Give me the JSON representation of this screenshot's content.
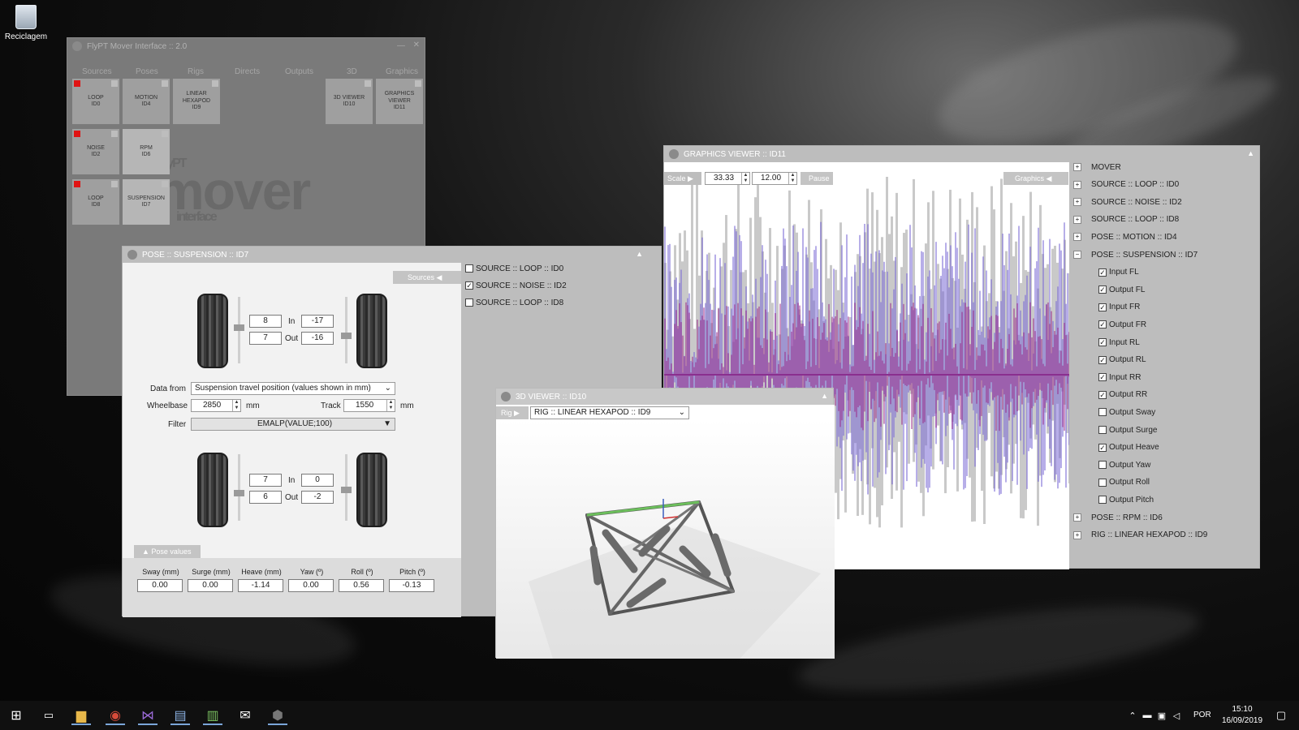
{
  "desktop": {
    "recycle_label": "Reciclagem"
  },
  "main_window": {
    "title": "FlyPT Mover Interface :: 2.0",
    "tabs": [
      "Sources",
      "Poses",
      "Rigs",
      "Directs",
      "Outputs",
      "3D",
      "Graphics"
    ],
    "modules": [
      {
        "label": "LOOP\nID0",
        "active": true
      },
      {
        "label": "MOTION\nID4",
        "active": false
      },
      {
        "label": "LINEAR\nHEXAPOD\nID9",
        "active": false
      },
      {
        "label": "3D VIEWER\nID10",
        "active": false
      },
      {
        "label": "GRAPHICS\nVIEWER\nID11",
        "active": false
      },
      {
        "label": "NOISE\nID2",
        "active": true
      },
      {
        "label": "RPM\nID6",
        "active": false
      },
      {
        "label": "LOOP\nID8",
        "active": true
      },
      {
        "label": "SUSPENSION\nID7",
        "active": false
      }
    ],
    "logo_small": "FlyPT",
    "logo_big": "mover",
    "logo_sub": "interface"
  },
  "pose_window": {
    "title": "POSE :: SUSPENSION :: ID7",
    "sources_button": "Sources",
    "front": {
      "in_left": "8",
      "in_right": "-17",
      "out_left": "7",
      "out_right": "-16"
    },
    "rear": {
      "in_left": "7",
      "in_right": "0",
      "out_left": "6",
      "out_right": "-2"
    },
    "in_label": "In",
    "out_label": "Out",
    "data_from_label": "Data from",
    "data_from_value": "Suspension travel position (values shown in mm)",
    "wheelbase_label": "Wheelbase",
    "wheelbase_value": "2850",
    "track_label": "Track",
    "track_value": "1550",
    "unit_mm": "mm",
    "filter_label": "Filter",
    "filter_value": "EMALP(VALUE;100)",
    "pose_values_label": "Pose values",
    "pose_headers": [
      "Sway (mm)",
      "Surge (mm)",
      "Heave (mm)",
      "Yaw (º)",
      "Roll (º)",
      "Pitch (º)"
    ],
    "pose_values": [
      "0.00",
      "0.00",
      "-1.14",
      "0.00",
      "0.56",
      "-0.13"
    ],
    "sources": [
      {
        "label": "SOURCE :: LOOP :: ID0",
        "checked": false
      },
      {
        "label": "SOURCE :: NOISE :: ID2",
        "checked": true
      },
      {
        "label": "SOURCE :: LOOP :: ID8",
        "checked": false
      }
    ]
  },
  "graphics_window": {
    "title": "GRAPHICS VIEWER :: ID11",
    "scale_label": "Scale",
    "scale_value1": "33.33",
    "scale_value2": "12.00",
    "pause_label": "Pause",
    "graphics_button": "Graphics",
    "tree_top": [
      "MOVER",
      "SOURCE :: LOOP :: ID0",
      "SOURCE :: NOISE :: ID2",
      "SOURCE :: LOOP :: ID8",
      "POSE :: MOTION :: ID4",
      "POSE :: SUSPENSION :: ID7"
    ],
    "tree_children": [
      {
        "label": "Input FL",
        "checked": true
      },
      {
        "label": "Output FL",
        "checked": true
      },
      {
        "label": "Input FR",
        "checked": true
      },
      {
        "label": "Output FR",
        "checked": true
      },
      {
        "label": "Input RL",
        "checked": true
      },
      {
        "label": "Output RL",
        "checked": true
      },
      {
        "label": "Input RR",
        "checked": true
      },
      {
        "label": "Output RR",
        "checked": true
      },
      {
        "label": "Output Sway",
        "checked": false
      },
      {
        "label": "Output Surge",
        "checked": false
      },
      {
        "label": "Output Heave",
        "checked": true
      },
      {
        "label": "Output Yaw",
        "checked": false
      },
      {
        "label": "Output Roll",
        "checked": false
      },
      {
        "label": "Output Pitch",
        "checked": false
      }
    ],
    "tree_bottom": [
      "POSE :: RPM :: ID6",
      "RIG :: LINEAR HEXAPOD :: ID9"
    ]
  },
  "viewer3d_window": {
    "title": "3D VIEWER :: ID10",
    "rig_label": "Rig",
    "rig_value": "RIG :: LINEAR HEXAPOD :: ID9"
  },
  "taskbar": {
    "lang": "POR",
    "time": "15:10",
    "date": "16/09/2019"
  }
}
